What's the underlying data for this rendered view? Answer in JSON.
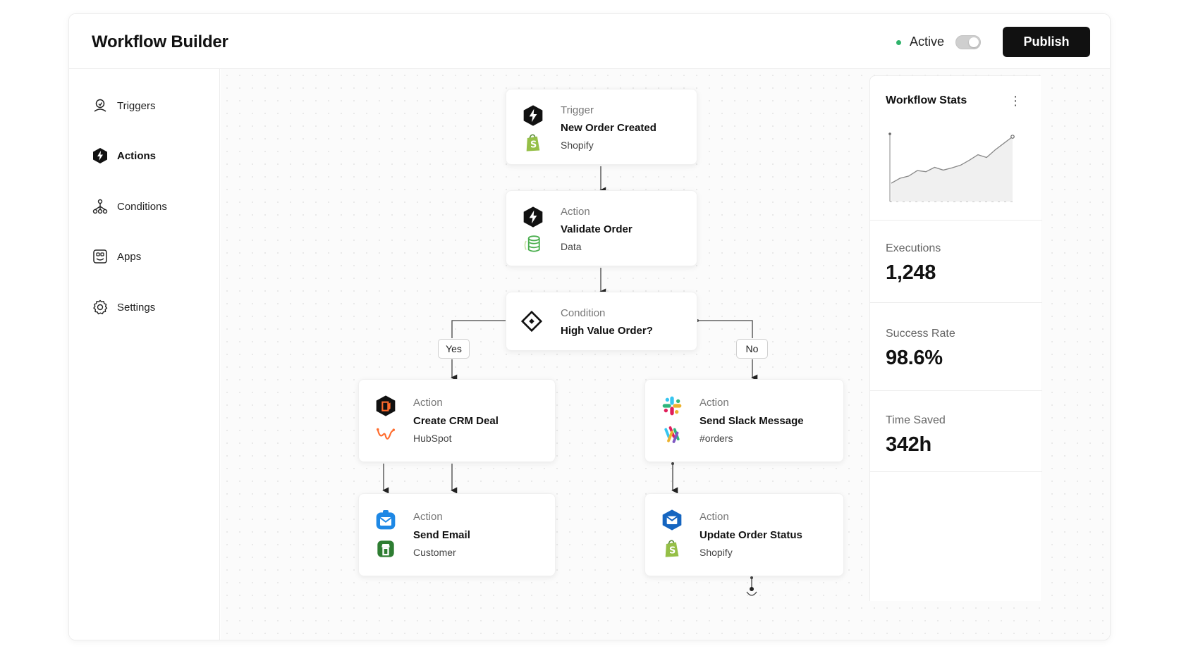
{
  "header": {
    "title": "Workflow Builder",
    "status_label": "Active",
    "publish_label": "Publish",
    "status_color": "#2fb36b"
  },
  "sidebar": {
    "items": [
      {
        "label": "Triggers",
        "icon": "trigger-icon"
      },
      {
        "label": "Actions",
        "icon": "lightning-hex-icon",
        "active": true
      },
      {
        "label": "Conditions",
        "icon": "branch-icon"
      },
      {
        "label": "Apps",
        "icon": "apps-grid-icon"
      },
      {
        "label": "Settings",
        "icon": "gear-icon"
      }
    ]
  },
  "workflow": {
    "nodes": [
      {
        "type": "Trigger",
        "title": "New Order Created",
        "subtitle": "Shopify",
        "icon": "lightning-hex-icon",
        "app_icon": "shopify-icon"
      },
      {
        "type": "Action",
        "title": "Validate Order",
        "subtitle": "Data",
        "icon": "lightning-hex-icon",
        "app_icon": "database-icon"
      },
      {
        "type": "Condition",
        "title": "High Value Order?",
        "icon": "diamond-icon"
      },
      {
        "type": "Action",
        "title": "Create CRM Deal",
        "subtitle": "HubSpot",
        "icon": "crm-icon",
        "app_icon": "hubspot-icon"
      },
      {
        "type": "Action",
        "title": "Send Slack Message",
        "subtitle": "#orders",
        "icon": "slack-icon",
        "app_icon": "slack-alt-icon"
      },
      {
        "type": "Action",
        "title": "Send Email",
        "subtitle": "Customer",
        "icon": "mail-icon",
        "app_icon": "store-icon"
      },
      {
        "type": "Action",
        "title": "Update Order Status",
        "subtitle": "Shopify",
        "icon": "mail-hex-icon",
        "app_icon": "shopify-icon"
      }
    ],
    "branches": {
      "yes": "Yes",
      "no": "No"
    }
  },
  "stats": {
    "title": "Workflow Stats",
    "executions_label": "Executions",
    "executions_value": "1,248",
    "success_label": "Success Rate",
    "success_value": "98.6%",
    "time_label": "Time Saved",
    "time_value": "342h",
    "sparkline": [
      5,
      14,
      18,
      28,
      26,
      34,
      29,
      33,
      38,
      47,
      57,
      52,
      66,
      78,
      90
    ]
  }
}
